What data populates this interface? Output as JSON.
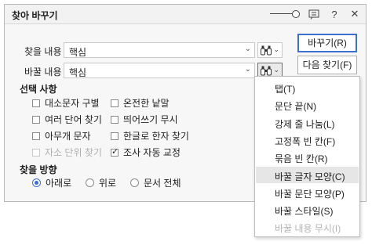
{
  "dialog": {
    "title": "찾아 바꾸기",
    "find_label": "찾을 내용",
    "find_value": "핵심",
    "replace_label": "바꿀 내용",
    "replace_value": "핵심"
  },
  "buttons": {
    "replace": "바꾸기(R)",
    "find_next": "다음 찾기(F)"
  },
  "options": {
    "title": "선택 사항",
    "items": [
      {
        "label": "대소문자 구별",
        "checked": false,
        "disabled": false
      },
      {
        "label": "온전한 낱말",
        "checked": false,
        "disabled": false
      },
      {
        "label": "여러 단어 찾기",
        "checked": false,
        "disabled": false
      },
      {
        "label": "띄어쓰기 무시",
        "checked": false,
        "disabled": false
      },
      {
        "label": "아무개 문자",
        "checked": false,
        "disabled": false
      },
      {
        "label": "한글로 한자 찾기",
        "checked": false,
        "disabled": false
      },
      {
        "label": "자소 단위 찾기",
        "checked": false,
        "disabled": true
      },
      {
        "label": "조사 자동 교정",
        "checked": true,
        "disabled": false
      }
    ]
  },
  "direction": {
    "title": "찾을 방향",
    "options": [
      "아래로",
      "위로",
      "문서 전체"
    ],
    "selected": "아래로"
  },
  "menu": {
    "items": [
      {
        "label": "탭(T)",
        "highlighted": false,
        "disabled": false
      },
      {
        "label": "문단 끝(N)",
        "highlighted": false,
        "disabled": false
      },
      {
        "label": "강제 줄 나눔(L)",
        "highlighted": false,
        "disabled": false
      },
      {
        "label": "고정폭 빈 칸(F)",
        "highlighted": false,
        "disabled": false
      },
      {
        "label": "묶음 빈 칸(R)",
        "highlighted": false,
        "disabled": false
      },
      {
        "label": "바꿀 글자 모양(C)",
        "highlighted": true,
        "disabled": false
      },
      {
        "label": "바꿀 문단 모양(P)",
        "highlighted": false,
        "disabled": false
      },
      {
        "label": "바꿀 스타일(S)",
        "highlighted": false,
        "disabled": false
      },
      {
        "label": "바꿀 내용 무시(I)",
        "highlighted": false,
        "disabled": true
      }
    ]
  },
  "icons": {
    "settings": "settings-icon",
    "help": "help-icon",
    "close": "close-icon",
    "binoculars": "binoculars-icon"
  }
}
